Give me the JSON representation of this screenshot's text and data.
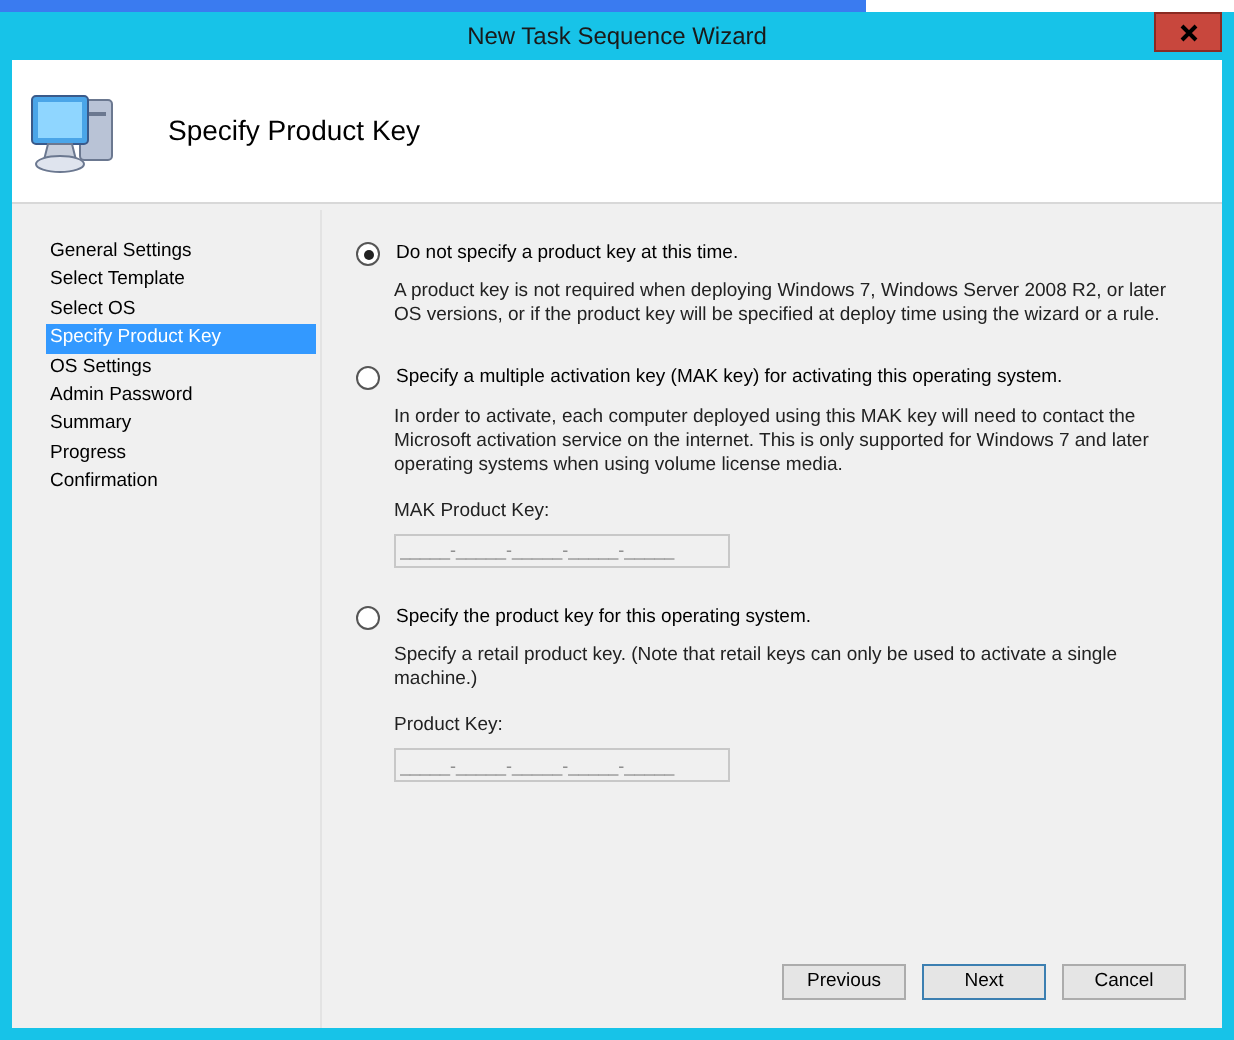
{
  "window": {
    "title": "New Task Sequence Wizard"
  },
  "header": {
    "title": "Specify Product Key"
  },
  "steps": [
    {
      "label": "General Settings",
      "selected": false
    },
    {
      "label": "Select Template",
      "selected": false
    },
    {
      "label": "Select OS",
      "selected": false
    },
    {
      "label": "Specify Product Key",
      "selected": true
    },
    {
      "label": "OS Settings",
      "selected": false
    },
    {
      "label": "Admin Password",
      "selected": false
    },
    {
      "label": "Summary",
      "selected": false
    },
    {
      "label": "Progress",
      "selected": false
    },
    {
      "label": "Confirmation",
      "selected": false
    }
  ],
  "options": [
    {
      "label": "Do not specify a product key at this time.",
      "selected": true,
      "description": "A product key is not required when deploying Windows 7, Windows Server 2008 R2, or later OS versions, or if the product key will be specified at deploy time using the wizard or a rule."
    },
    {
      "label": "Specify a multiple activation key (MAK key) for activating this operating system.",
      "selected": false,
      "description": "In order to activate, each computer deployed using this MAK key will need to contact the Microsoft activation service on the internet.  This is only supported for Windows 7 and later operating systems when using volume license media.",
      "field": {
        "label": "MAK Product Key:",
        "value": "_____-_____-_____-_____-_____",
        "disabled": true
      }
    },
    {
      "label": "Specify the product key for this operating system.",
      "selected": false,
      "description": "Specify a retail product key.  (Note that retail keys can only be used to activate a single machine.)",
      "field": {
        "label": "Product Key:",
        "value": "_____-_____-_____-_____-_____",
        "disabled": true
      }
    }
  ],
  "buttons": [
    {
      "label": "Previous",
      "kind": "normal"
    },
    {
      "label": "Next",
      "kind": "default"
    },
    {
      "label": "Cancel",
      "kind": "normal"
    }
  ]
}
